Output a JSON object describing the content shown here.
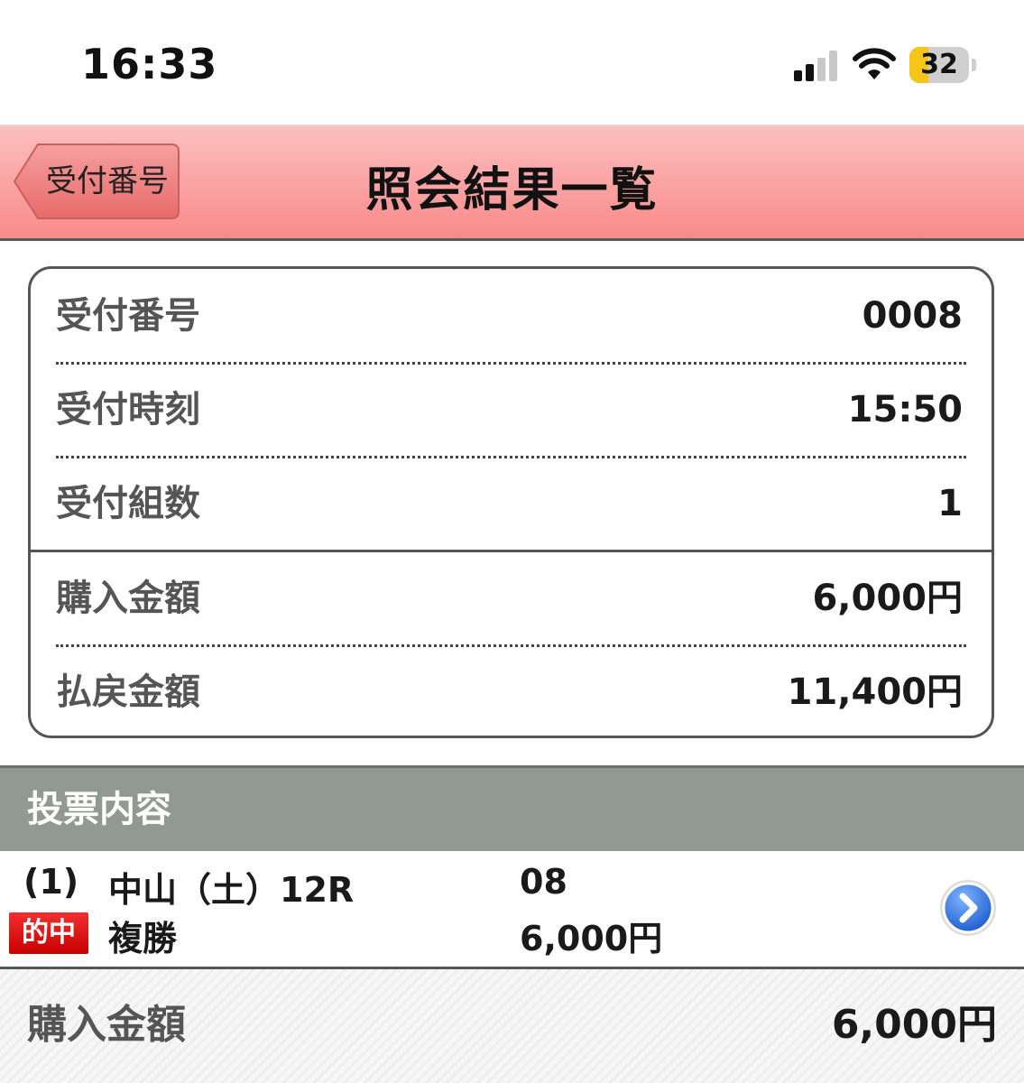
{
  "status_bar": {
    "time": "16:33",
    "battery_level": "32",
    "signal_icon": "cellular-signal-icon",
    "wifi_icon": "wifi-icon",
    "battery_icon": "battery-icon"
  },
  "nav": {
    "back_label": "受付番号",
    "title": "照会結果一覧",
    "accent_color": "#f98a8a"
  },
  "summary": {
    "rows": [
      {
        "label": "受付番号",
        "value": "0008"
      },
      {
        "label": "受付時刻",
        "value": "15:50"
      },
      {
        "label": "受付組数",
        "value": "1"
      },
      {
        "label": "購入金額",
        "value": "6,000円"
      },
      {
        "label": "払戻金額",
        "value": "11,400円"
      }
    ]
  },
  "votes": {
    "section_title": "投票内容",
    "items": [
      {
        "index": "(1)",
        "race": "中山（土）12R",
        "number": "08",
        "badge": "的中",
        "badge_color": "#e01010",
        "bet_type": "複勝",
        "amount": "6,000円",
        "detail_icon": "chevron-right-icon"
      }
    ]
  },
  "total": {
    "label": "購入金額",
    "value": "6,000円"
  }
}
